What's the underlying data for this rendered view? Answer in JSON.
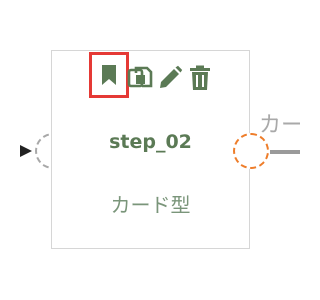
{
  "node": {
    "title": "step_02",
    "type_label": "カード型"
  },
  "toolbar": {
    "icons": [
      "bookmark-icon",
      "copy-icon",
      "edit-pencil-icon",
      "trash-icon"
    ],
    "highlighted": "bookmark-icon"
  },
  "edge": {
    "label": "カー"
  },
  "colors": {
    "icon": "#5b7a55",
    "title": "#5b7a55",
    "type_label": "#7a957a",
    "highlight_box": "#e53935",
    "in_port": "#a8a8a8",
    "out_port": "#ee7d2a",
    "edge_label": "#a9a9a9"
  }
}
